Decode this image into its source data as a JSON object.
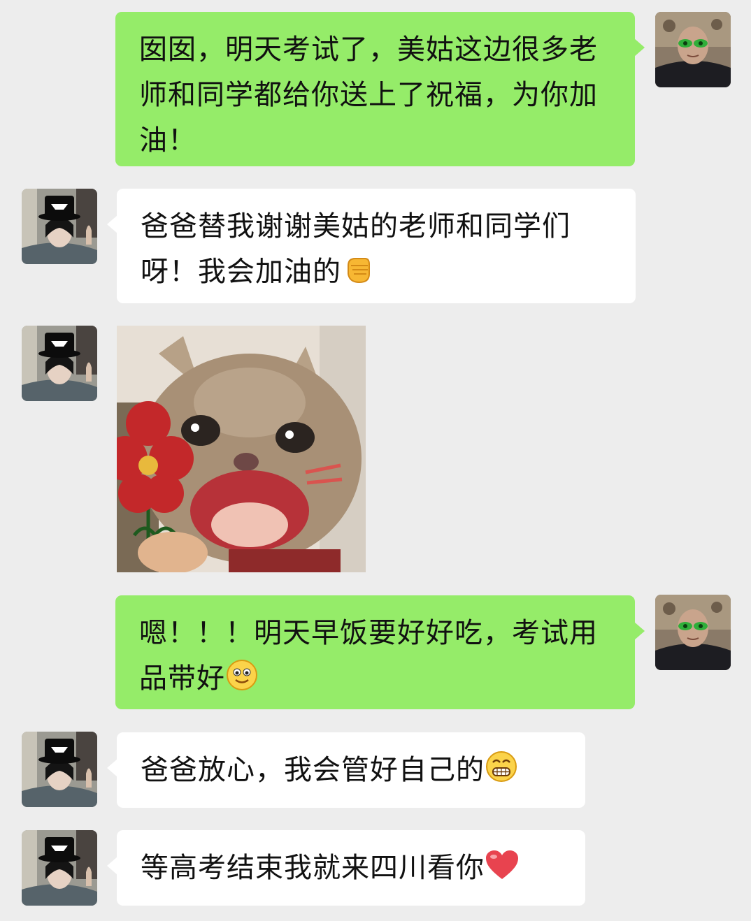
{
  "messages": [
    {
      "side": "right",
      "text": "囡囡，明天考试了，美姑这边很多老师和同学都给你送上了祝福，为你加油！"
    },
    {
      "side": "left",
      "text": "爸爸替我谢谢美姑的老师和同学们呀！我会加油的",
      "emoji": "fist-emoji"
    },
    {
      "side": "left",
      "type": "sticker",
      "sticker": "cat-with-flower-sticker"
    },
    {
      "side": "right",
      "text": "嗯！！！明天早饭要好好吃，考试用品带好",
      "emoji": "smile-emoji"
    },
    {
      "side": "left",
      "text": "爸爸放心，我会管好自己的",
      "emoji": "grin-emoji"
    },
    {
      "side": "left",
      "text": "等高考结束我就来四川看你",
      "emoji": "heart-emoji"
    }
  ],
  "colors": {
    "background": "#ededed",
    "sent_bubble": "#95ec69",
    "received_bubble": "#ffffff"
  }
}
